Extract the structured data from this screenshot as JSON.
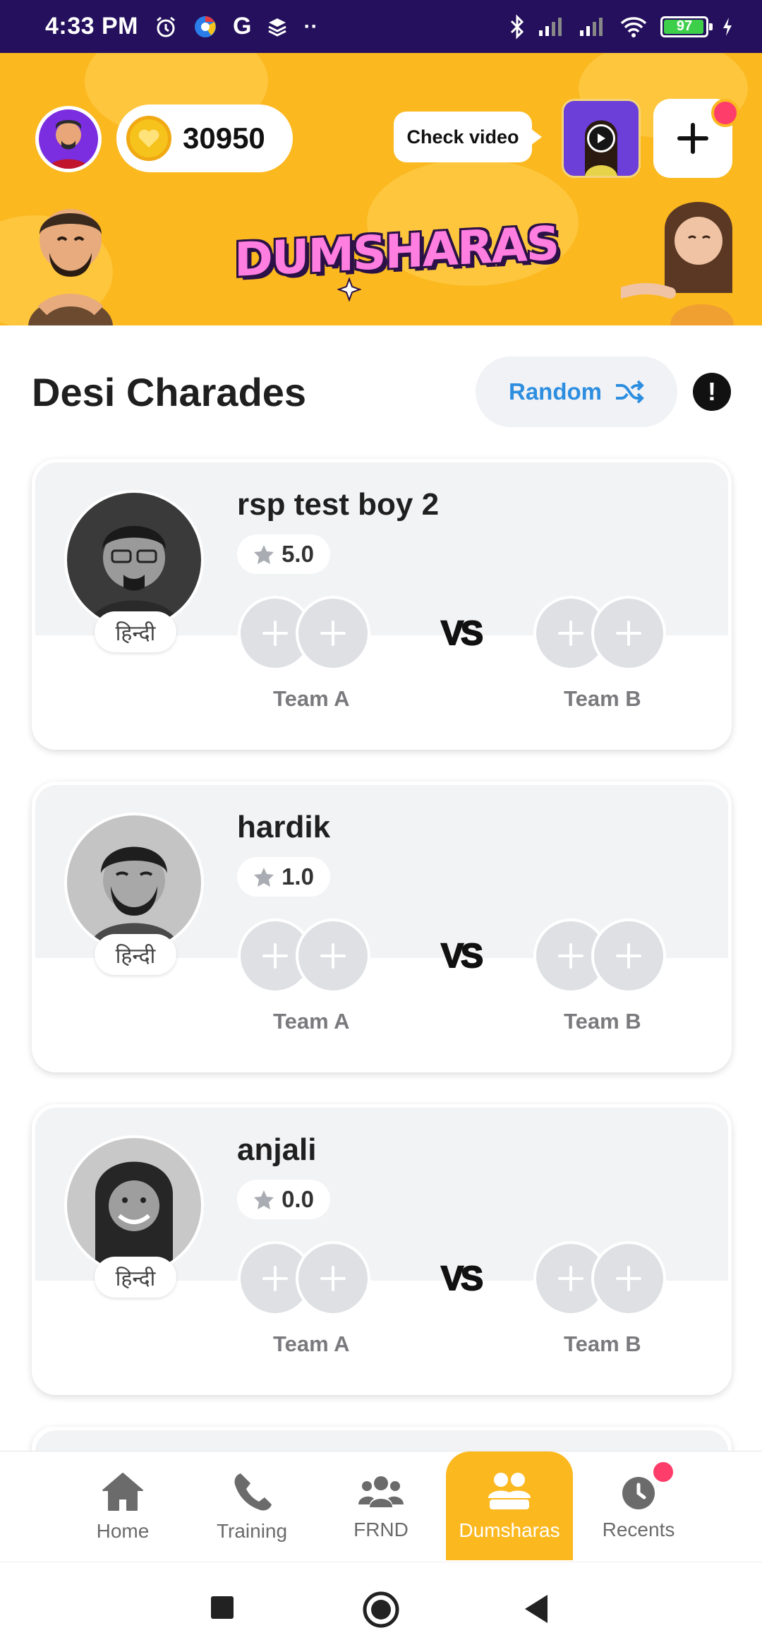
{
  "status_bar": {
    "time": "4:33 PM",
    "battery": "97",
    "battery_level": 0.97
  },
  "header": {
    "coins": "30950",
    "check_video_label": "Check video",
    "logo_text": "DUMSHARAS"
  },
  "section": {
    "title": "Desi Charades",
    "random_label": "Random"
  },
  "rooms": [
    {
      "host": "rsp test boy 2",
      "language": "हिन्दी",
      "rating": "5.0",
      "team_a": "Team A",
      "vs": "VS",
      "team_b": "Team B"
    },
    {
      "host": "hardik",
      "language": "हिन्दी",
      "rating": "1.0",
      "team_a": "Team A",
      "vs": "VS",
      "team_b": "Team B"
    },
    {
      "host": "anjali",
      "language": "हिन्दी",
      "rating": "0.0",
      "team_a": "Team A",
      "vs": "VS",
      "team_b": "Team B"
    }
  ],
  "bottom_nav": {
    "items": [
      {
        "label": "Home",
        "icon": "home-icon"
      },
      {
        "label": "Training",
        "icon": "phone-icon"
      },
      {
        "label": "FRND",
        "icon": "friends-icon"
      },
      {
        "label": "Dumsharas",
        "icon": "group-icon",
        "active": true
      },
      {
        "label": "Recents",
        "icon": "clock-icon"
      }
    ]
  },
  "colors": {
    "brand_yellow": "#fbb81f",
    "status_bar": "#24105c",
    "accent_blue": "#2d8ee0",
    "notification": "#ff3d6b"
  }
}
